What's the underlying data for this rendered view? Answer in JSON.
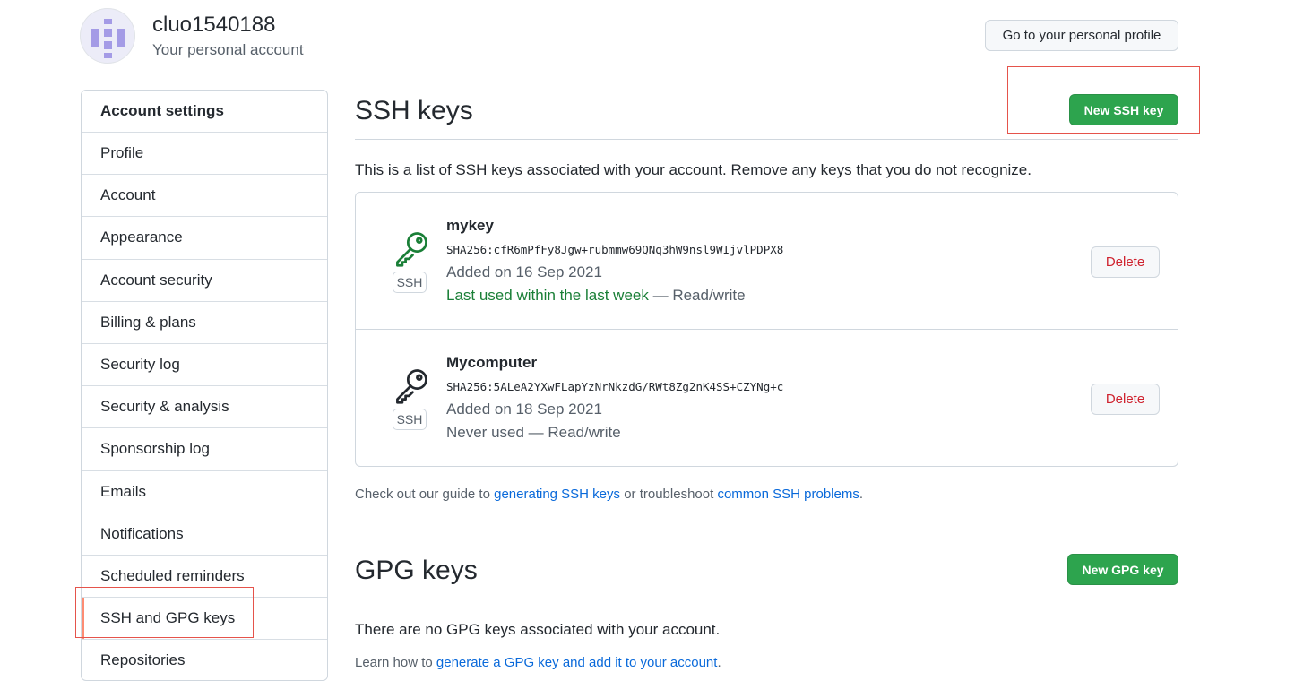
{
  "user": {
    "name": "cluo1540188",
    "subtitle": "Your personal account",
    "profile_button": "Go to your personal profile"
  },
  "sidebar": {
    "heading": "Account settings",
    "items": [
      {
        "label": "Profile"
      },
      {
        "label": "Account"
      },
      {
        "label": "Appearance"
      },
      {
        "label": "Account security"
      },
      {
        "label": "Billing & plans"
      },
      {
        "label": "Security log"
      },
      {
        "label": "Security & analysis"
      },
      {
        "label": "Sponsorship log"
      },
      {
        "label": "Emails"
      },
      {
        "label": "Notifications"
      },
      {
        "label": "Scheduled reminders"
      },
      {
        "label": "SSH and GPG keys",
        "active": true
      },
      {
        "label": "Repositories"
      }
    ]
  },
  "ssh": {
    "title": "SSH keys",
    "new_button": "New SSH key",
    "description": "This is a list of SSH keys associated with your account. Remove any keys that you do not recognize.",
    "keys": [
      {
        "name": "mykey",
        "fingerprint": "SHA256:cfR6mPfFy8Jgw+rubmmw69QNq3hW9nsl9WIjvlPDPX8",
        "added": "Added on 16 Sep 2021",
        "last_used": "Last used within the last week",
        "access": "— Read/write",
        "type_label": "SSH",
        "delete_label": "Delete",
        "icon_color": "#1a7f37"
      },
      {
        "name": "Mycomputer",
        "fingerprint": "SHA256:5ALeA2YXwFLapYzNrNkzdG/RWt8Zg2nK4SS+CZYNg+c",
        "added": "Added on 18 Sep 2021",
        "last_used": "Never used",
        "access": "— Read/write",
        "type_label": "SSH",
        "delete_label": "Delete",
        "icon_color": "#24292f"
      }
    ],
    "guide_prefix": "Check out our guide to",
    "guide_link1": "generating SSH keys",
    "guide_middle": "or troubleshoot",
    "guide_link2": "common SSH problems",
    "guide_suffix": "."
  },
  "gpg": {
    "title": "GPG keys",
    "new_button": "New GPG key",
    "empty_text": "There are no GPG keys associated with your account.",
    "learn_prefix": "Learn how to",
    "learn_link": "generate a GPG key and add it to your account",
    "learn_suffix": "."
  },
  "colors": {
    "accent_green": "#2da44e",
    "danger": "#cf222e",
    "link": "#0969da",
    "highlight_box": "#e5534b"
  }
}
